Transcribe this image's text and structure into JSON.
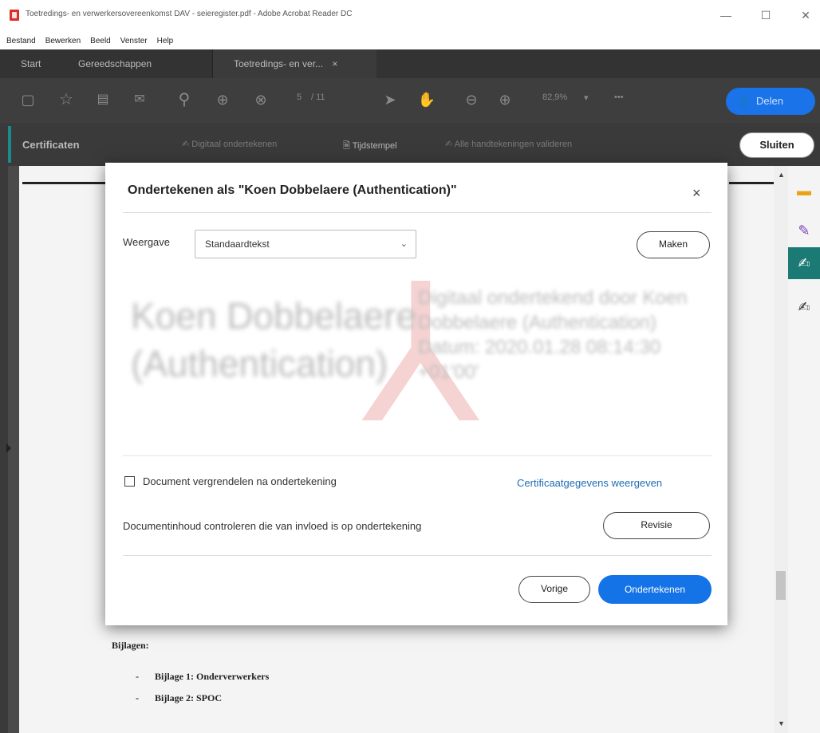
{
  "window": {
    "title": "Toetredings- en verwerkersovereenkomst DAV - seieregister.pdf - Adobe Acrobat Reader DC",
    "minimize_glyph": "—",
    "maximize_glyph": "☐",
    "close_glyph": "✕"
  },
  "menu": [
    "Bestand",
    "Bewerken",
    "Beeld",
    "Venster",
    "Help"
  ],
  "tabs": {
    "start": "Start",
    "tools": "Gereedschappen",
    "document": "Toetredings- en ver...",
    "document_close": "×"
  },
  "toolbar": {
    "page_current": "5",
    "page_total": "/ 11",
    "zoom": "82,9%",
    "zoom_caret": "▾",
    "more": "•••",
    "share_label": "Delen"
  },
  "cert_bar": {
    "label": "Certificaten",
    "digital_sign": "Digitaal ondertekenen",
    "timestamp": "Tijdstempel",
    "validate_all": "Alle handtekeningen valideren",
    "close_label": "Sluiten"
  },
  "dialog": {
    "title": "Ondertekenen als \"Koen Dobbelaere (Authentication)\"",
    "close_glyph": "×",
    "appearance_label": "Weergave",
    "appearance_value": "Standaardtekst",
    "create_label": "Maken",
    "preview_name": "Koen Dobbelaere (Authentication)",
    "preview_details": "Digitaal ondertekend door Koen Dobbelaere (Authentication) Datum: 2020.01.28 08:14:30 +01'00'",
    "lock_checkbox_label": "Document vergrendelen na ondertekening",
    "lock_checked": false,
    "cert_details_link": "Certificaatgegevens weergeven",
    "review_text": "Documentinhoud controleren die van invloed is op ondertekening",
    "review_button": "Revisie",
    "back_button": "Vorige",
    "sign_button": "Ondertekenen"
  },
  "document": {
    "attachments_heading": "Bijlagen:",
    "attachments": [
      {
        "dash": "-",
        "label": "Bijlage 1: Onderverwerkers"
      },
      {
        "dash": "-",
        "label": "Bijlage 2: SPOC"
      }
    ]
  },
  "icons": {
    "save": "save-icon",
    "bookmark": "star-icon",
    "print": "print-icon",
    "email": "mail-icon",
    "search": "zoom-search-icon",
    "page_up": "arrow-up-circle-icon",
    "page_down": "arrow-down-circle-icon",
    "select": "cursor-icon",
    "hand": "hand-icon",
    "zoom_out": "minus-circle-icon",
    "zoom_in": "plus-circle-icon"
  },
  "colors": {
    "accent_blue": "#1473e6",
    "teal_accent": "#1c8a8a",
    "link": "#1f6db5"
  }
}
